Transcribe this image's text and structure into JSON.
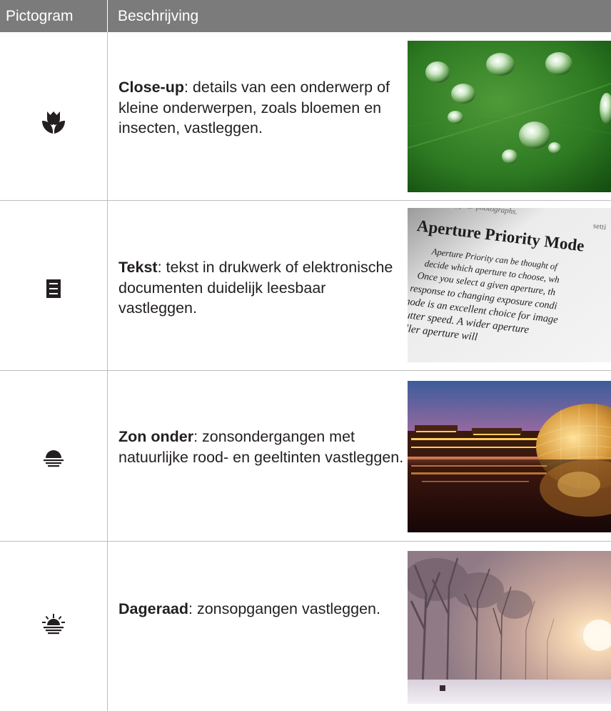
{
  "header": {
    "pictogram_label": "Pictogram",
    "description_label": "Beschrijving"
  },
  "rows": [
    {
      "icon": "macro-flower-icon",
      "title": "Close-up",
      "text": ": details van een onderwerp of kleine onderwerpen, zoals bloemen en insecten, vastleggen.",
      "photo": "water-droplets-on-leaf"
    },
    {
      "icon": "text-document-icon",
      "title": "Tekst",
      "text": ": tekst in drukwerk of elektronische documenten duidelijk leesbaar vastleggen.",
      "photo": "printed-book-page",
      "photo_text": {
        "line0": "of your photographs.",
        "line0b": "setti",
        "heading": "Aperture Priority Mode",
        "line1": "Aperture Priority can be thought of",
        "line2": "decide which aperture to choose, wh",
        "line3": "Once you select a given aperture, th",
        "line4": "response to changing exposure condi",
        "line5": "mode is an excellent choice for image",
        "line6": "shutter speed. A wider aperture",
        "line7": "smaller aperture will"
      }
    },
    {
      "icon": "sunset-icon",
      "title": "Zon onder",
      "text": ": zonsondergangen met natuurlijke rood- en geeltinten vastleggen.",
      "photo": "sunset-city-dome-reflection"
    },
    {
      "icon": "dawn-icon",
      "title": "Dageraad",
      "text": ": zonsopgangen vastleggen.",
      "photo": "misty-winter-sunrise-trees"
    }
  ]
}
